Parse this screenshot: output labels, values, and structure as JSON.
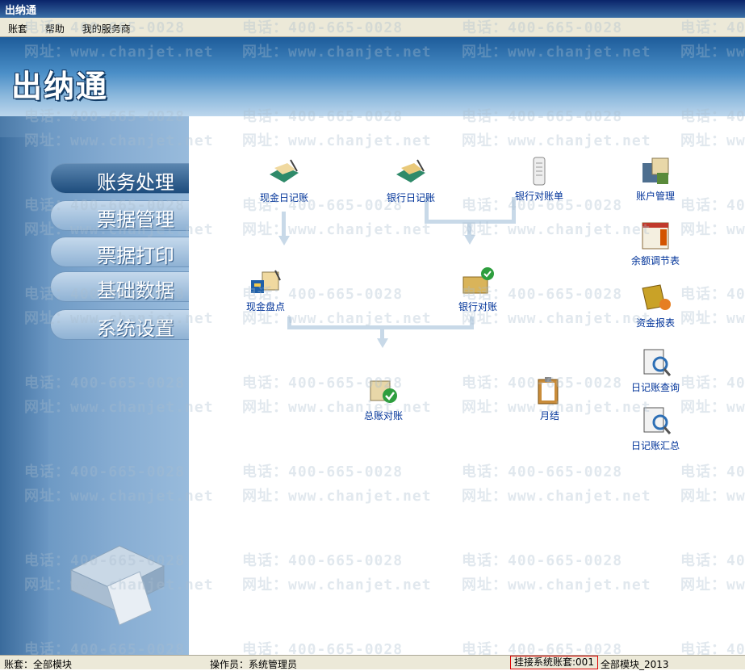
{
  "window": {
    "title": "出纳通"
  },
  "menu": [
    "账套",
    "帮助",
    "我的服务商"
  ],
  "header": {
    "logo": "出纳通"
  },
  "nav": [
    {
      "label": "账务处理",
      "active": true
    },
    {
      "label": "票据管理",
      "active": false
    },
    {
      "label": "票据打印",
      "active": false
    },
    {
      "label": "基础数据",
      "active": false
    },
    {
      "label": "系统设置",
      "active": false
    }
  ],
  "main": {
    "cash_journal": "现金日记账",
    "bank_journal": "银行日记账",
    "bank_statement": "银行对账单",
    "cash_count": "现金盘点",
    "bank_reconcile": "银行对账",
    "ledger_reconcile": "总账对账",
    "month_close": "月结",
    "account_mgmt": "账户管理",
    "balance_adjust": "余额调节表",
    "fund_report": "资金报表",
    "journal_query": "日记账查询",
    "journal_summary": "日记账汇总"
  },
  "watermark": {
    "phone": "电话：400-665-0028",
    "site": "网址：www.chanjet.net"
  },
  "status": {
    "account": "账套：全部模块",
    "operator": "操作员：系统管理员",
    "linked": "挂接系统账套:001",
    "module": "全部模块_2013"
  }
}
